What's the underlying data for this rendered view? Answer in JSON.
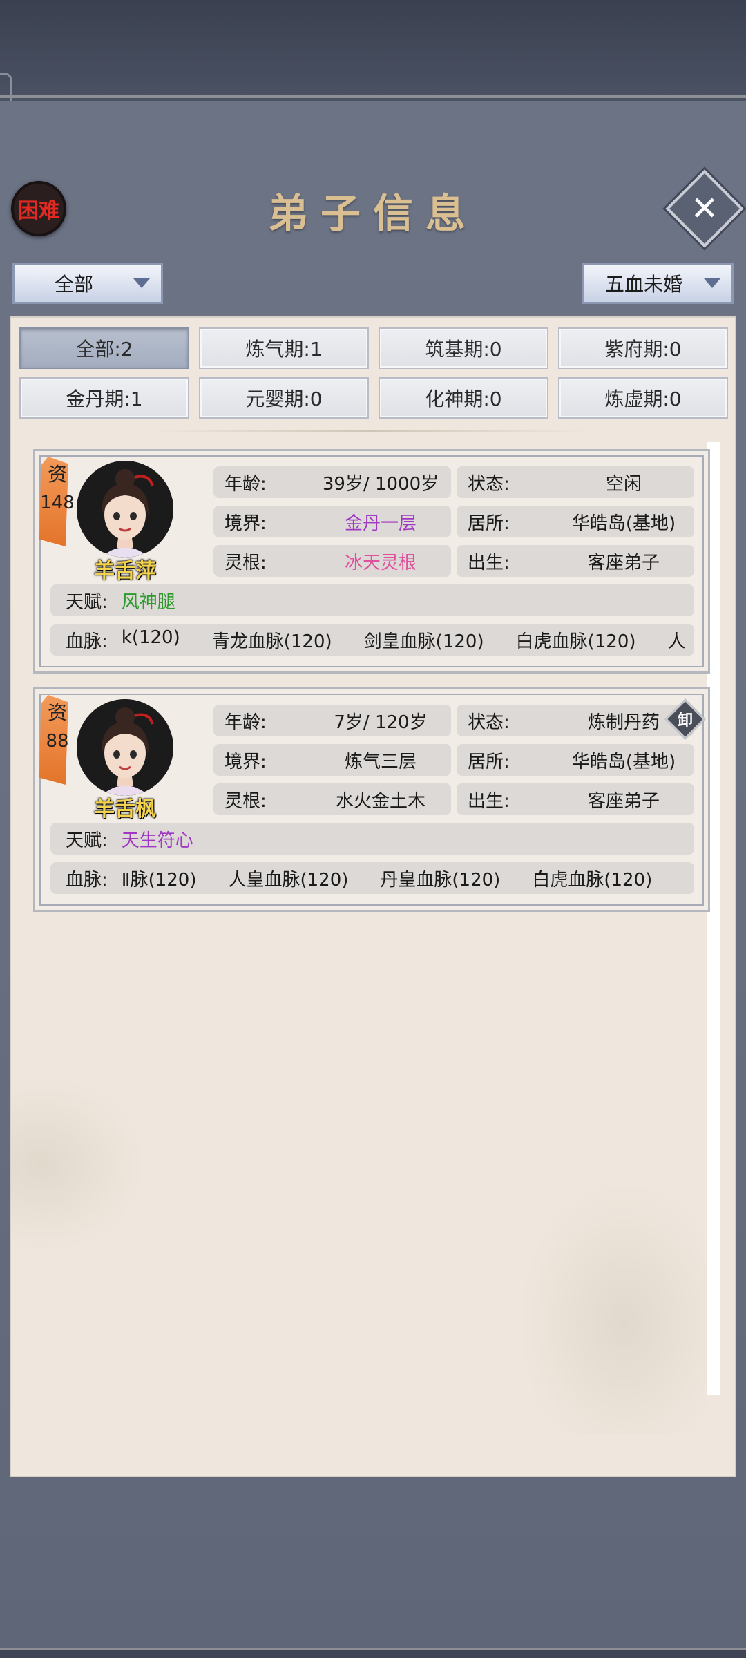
{
  "header": {
    "difficulty": "困难",
    "title": "弟子信息",
    "close_label": "✕"
  },
  "filters": {
    "category": "全部",
    "marriage": "五血未婚"
  },
  "realm_chips": [
    {
      "label": "全部:2",
      "active": true
    },
    {
      "label": "炼气期:1",
      "active": false
    },
    {
      "label": "筑基期:0",
      "active": false
    },
    {
      "label": "紫府期:0",
      "active": false
    },
    {
      "label": "金丹期:1",
      "active": false
    },
    {
      "label": "元婴期:0",
      "active": false
    },
    {
      "label": "化神期:0",
      "active": false
    },
    {
      "label": "炼虚期:0",
      "active": false
    }
  ],
  "labels": {
    "age": "年龄:",
    "state": "状态:",
    "realm": "境界:",
    "home": "居所:",
    "root": "灵根:",
    "birth": "出生:",
    "talent": "天赋:",
    "blood": "血脉:",
    "rank": "资"
  },
  "disciples": [
    {
      "rank": "148",
      "name": "羊舌萍",
      "age": "39岁/ 1000岁",
      "state": "空闲",
      "realm": "金丹一层",
      "home": "华皓岛(基地)",
      "root": "冰天灵根",
      "birth": "客座弟子",
      "talent": "风神腿",
      "bloodlines": [
        "k(120)",
        "青龙血脉(120)",
        "剑皇血脉(120)",
        "白虎血脉(120)",
        "人"
      ]
    },
    {
      "rank": "88",
      "name": "羊舌枫",
      "age": "7岁/ 120岁",
      "state": "炼制丹药",
      "realm": "炼气三层",
      "home": "华皓岛(基地)",
      "root": "水火金土木",
      "birth": "客座弟子",
      "talent": "天生符心",
      "bloodlines": [
        "Ⅱ脉(120)",
        "人皇血脉(120)",
        "丹皇血脉(120)",
        "白虎血脉(120)"
      ],
      "unequip_label": "卸"
    }
  ]
}
